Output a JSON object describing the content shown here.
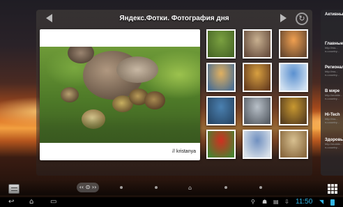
{
  "widget": {
    "title": "Яндекс.Фотки. Фотография дня",
    "photo_credit": "// kristanya"
  },
  "side_panel": {
    "items": [
      {
        "title": "Активные",
        "lines": []
      },
      {
        "title": "Главные",
        "lines": [
          "http://rss...",
          "ru.country..."
        ]
      },
      {
        "title": "Регионал",
        "lines": [
          "http://rss...",
          "ru.country..."
        ]
      },
      {
        "title": "В мире",
        "lines": [
          "http://mobile...",
          "ru.country..."
        ]
      },
      {
        "title": "Hi-Tech",
        "lines": [
          "http://rss...",
          "ru.country..."
        ]
      },
      {
        "title": "Здоровь",
        "lines": [
          "http://mobile...",
          "ru.country..."
        ]
      }
    ]
  },
  "dock": {
    "pager_label": "‹‹ ⊙ ››",
    "home_glyph": "⌂"
  },
  "statusbar": {
    "time": "11:50",
    "back_glyph": "↩",
    "home_glyph": "⌂",
    "recent_glyph": "▭"
  },
  "thumbnails": [
    {
      "name": "ducks",
      "c1": "#7aa040",
      "c2": "#4a6a28"
    },
    {
      "name": "cat",
      "c1": "#c8b090",
      "c2": "#6a5040"
    },
    {
      "name": "sunset-tree",
      "c1": "#f0a050",
      "c2": "#6a4a30"
    },
    {
      "name": "lake-sunset",
      "c1": "#e0b060",
      "c2": "#507090"
    },
    {
      "name": "forest-light",
      "c1": "#d8a040",
      "c2": "#6a4020"
    },
    {
      "name": "blue-sky",
      "c1": "#5a90d0",
      "c2": "#d0e0f0"
    },
    {
      "name": "ducks-water",
      "c1": "#4a80b0",
      "c2": "#2a4a6a"
    },
    {
      "name": "winter-field",
      "c1": "#b8c0c8",
      "c2": "#5a6068"
    },
    {
      "name": "golden-landscape",
      "c1": "#c89830",
      "c2": "#5a4020"
    },
    {
      "name": "red-poppies",
      "c1": "#d03020",
      "c2": "#4a8030"
    },
    {
      "name": "mountain-lake",
      "c1": "#7090c0",
      "c2": "#d8e0e8"
    },
    {
      "name": "arch-hall",
      "c1": "#d8c090",
      "c2": "#8a6a40"
    }
  ]
}
